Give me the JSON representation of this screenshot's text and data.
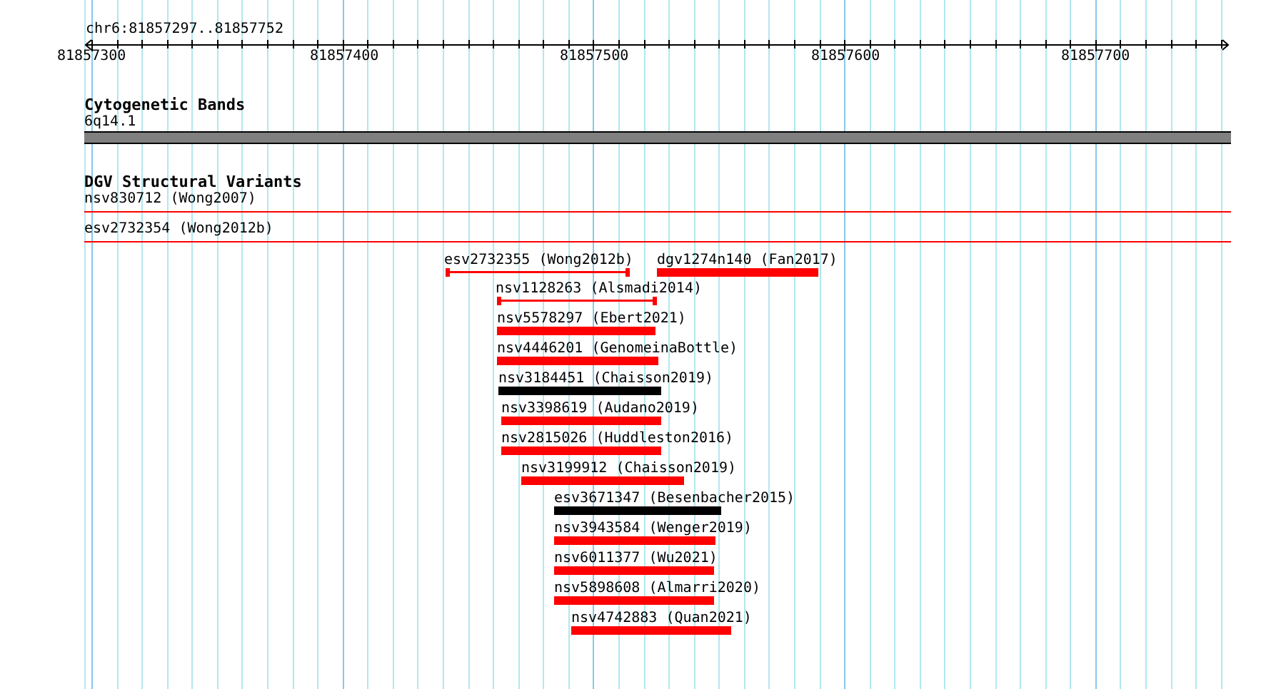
{
  "location": "chr6:81857297..81857752",
  "ruler": {
    "ticks": [
      "81857300",
      "81857400",
      "81857500",
      "81857600",
      "81857700"
    ]
  },
  "tracks": [
    {
      "title": "Cytogenetic Bands",
      "features": [
        {
          "label": "6q14.1",
          "kind": "band",
          "color": "#808080"
        }
      ]
    },
    {
      "title": "DGV Structural Variants",
      "features": [
        {
          "label": "nsv830712 (Wong2007)",
          "kind": "line",
          "color": "#ff0000"
        },
        {
          "label": "esv2732354 (Wong2012b)",
          "kind": "line",
          "color": "#ff0000"
        },
        {
          "label": "esv2732355 (Wong2012b)",
          "kind": "span",
          "color": "#ff0000"
        },
        {
          "label": "dgv1274n140 (Fan2017)",
          "kind": "bar",
          "color": "#ff0000"
        },
        {
          "label": "nsv1128263 (Alsmadi2014)",
          "kind": "span",
          "color": "#ff0000"
        },
        {
          "label": "nsv5578297 (Ebert2021)",
          "kind": "bar",
          "color": "#ff0000"
        },
        {
          "label": "nsv4446201 (GenomeinaBottle)",
          "kind": "bar",
          "color": "#ff0000"
        },
        {
          "label": "nsv3184451 (Chaisson2019)",
          "kind": "bar",
          "color": "#000000"
        },
        {
          "label": "nsv3398619 (Audano2019)",
          "kind": "bar",
          "color": "#ff0000"
        },
        {
          "label": "nsv2815026 (Huddleston2016)",
          "kind": "bar",
          "color": "#ff0000"
        },
        {
          "label": "nsv3199912 (Chaisson2019)",
          "kind": "bar",
          "color": "#ff0000"
        },
        {
          "label": "esv3671347 (Besenbacher2015)",
          "kind": "bar",
          "color": "#000000"
        },
        {
          "label": "nsv3943584 (Wenger2019)",
          "kind": "bar",
          "color": "#ff0000"
        },
        {
          "label": "nsv6011377 (Wu2021)",
          "kind": "bar",
          "color": "#ff0000"
        },
        {
          "label": "nsv5898608 (Almarri2020)",
          "kind": "bar",
          "color": "#ff0000"
        },
        {
          "label": "nsv4742883 (Quan2021)",
          "kind": "bar",
          "color": "#ff0000"
        }
      ]
    }
  ]
}
